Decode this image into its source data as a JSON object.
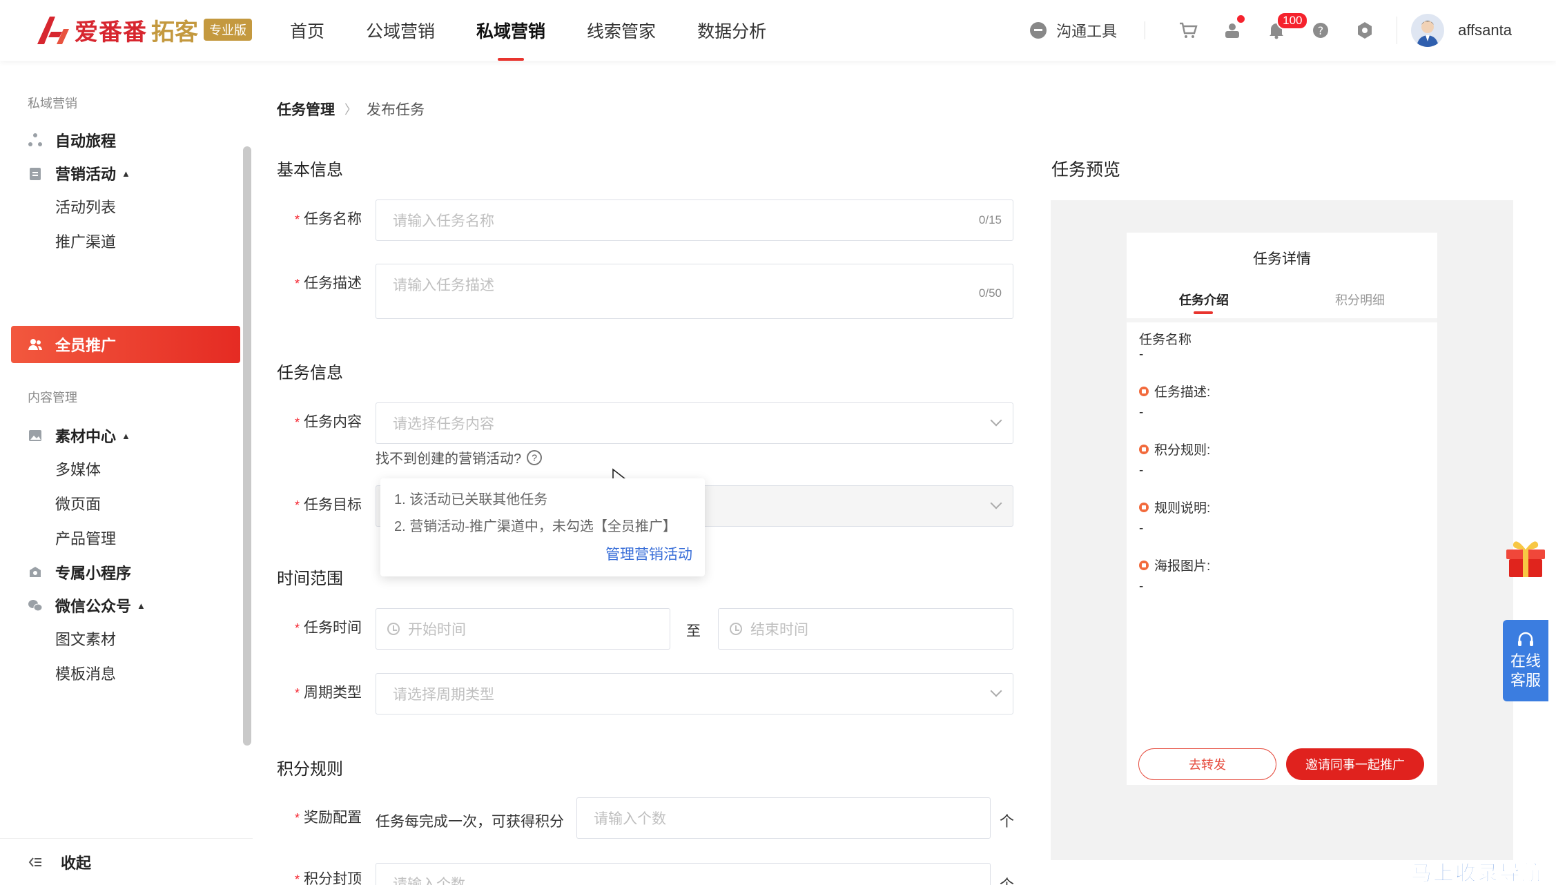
{
  "header": {
    "logo": {
      "brand": "爱番番",
      "product": "拓客",
      "edition": "专业版"
    },
    "nav": [
      "首页",
      "公域营销",
      "私域营销",
      "线索管家",
      "数据分析"
    ],
    "nav_active": 2,
    "tool_link": "沟通工具",
    "notification_count": "100",
    "username": "affsanta"
  },
  "sidebar": {
    "group1": "私域营销",
    "items": [
      {
        "label": "自动旅程"
      },
      {
        "label": "营销活动"
      },
      {
        "label": "活动列表"
      },
      {
        "label": "推广渠道"
      },
      {
        "label": "全员推广"
      },
      {
        "label": "素材中心"
      },
      {
        "label": "多媒体"
      },
      {
        "label": "微页面"
      },
      {
        "label": "产品管理"
      },
      {
        "label": "专属小程序"
      },
      {
        "label": "微信公众号"
      },
      {
        "label": "图文素材"
      },
      {
        "label": "模板消息"
      }
    ],
    "group2": "内容管理",
    "collapse": "收起"
  },
  "breadcrumb": {
    "parent": "任务管理",
    "current": "发布任务"
  },
  "form": {
    "basic_title": "基本信息",
    "name_label": "任务名称",
    "name_placeholder": "请输入任务名称",
    "name_counter": "0/15",
    "desc_label": "任务描述",
    "desc_placeholder": "请输入任务描述",
    "desc_counter": "0/50",
    "task_title": "任务信息",
    "content_label": "任务内容",
    "content_placeholder": "请选择任务内容",
    "hint": "找不到创建的营销活动?",
    "target_label": "任务目标",
    "popover": {
      "line1": "1. 该活动已关联其他任务",
      "line2": "2. 营销活动-推广渠道中，未勾选【全员推广】",
      "link": "管理营销活动"
    },
    "time_title": "时间范围",
    "time_label": "任务时间",
    "start_placeholder": "开始时间",
    "to": "至",
    "end_placeholder": "结束时间",
    "cycle_label": "周期类型",
    "cycle_placeholder": "请选择周期类型",
    "points_title": "积分规则",
    "reward_label": "奖励配置",
    "reward_text": "任务每完成一次，可获得积分",
    "reward_placeholder": "请输入个数",
    "unit": "个",
    "cap_label": "积分封顶",
    "cap_placeholder": "请输入个数"
  },
  "preview": {
    "title": "任务预览",
    "phone_title": "任务详情",
    "tab_intro": "任务介绍",
    "tab_points": "积分明细",
    "name_label": "任务名称",
    "name_value": "-",
    "desc_label": "任务描述:",
    "desc_value": "-",
    "rule_label": "积分规则:",
    "rule_value": "-",
    "explain_label": "规则说明:",
    "explain_value": "-",
    "poster_label": "海报图片:",
    "poster_value": "-",
    "btn_share": "去转发",
    "btn_invite": "邀请同事一起推广"
  },
  "widgets": {
    "service": [
      "在线",
      "客服"
    ],
    "watermark": "马上收录导航"
  }
}
